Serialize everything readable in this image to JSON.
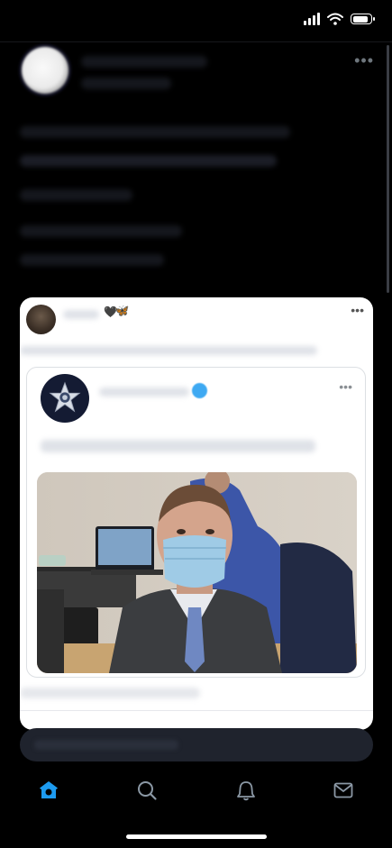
{
  "status_bar": {
    "signal_bars": 4,
    "battery_level": 0.9,
    "icons": [
      "signal-icon",
      "wifi-icon",
      "battery-icon"
    ]
  },
  "post": {
    "more_label": "•••"
  },
  "embedded_card": {
    "emoji": "🖤🦋",
    "more_label": "•••",
    "quoted_post": {
      "more_label": "•••",
      "logo": "police-star-badge-logo",
      "image": "photo-man-wearing-face-mask-in-courtroom"
    }
  },
  "tab_bar": {
    "items": [
      {
        "name": "home",
        "icon": "home-icon",
        "active": true
      },
      {
        "name": "search",
        "icon": "search-icon",
        "active": false
      },
      {
        "name": "notifications",
        "icon": "bell-icon",
        "active": false
      },
      {
        "name": "messages",
        "icon": "mail-icon",
        "active": false
      }
    ]
  },
  "colors": {
    "background": "#000000",
    "accent": "#1d9bf0",
    "card": "#ffffff"
  }
}
